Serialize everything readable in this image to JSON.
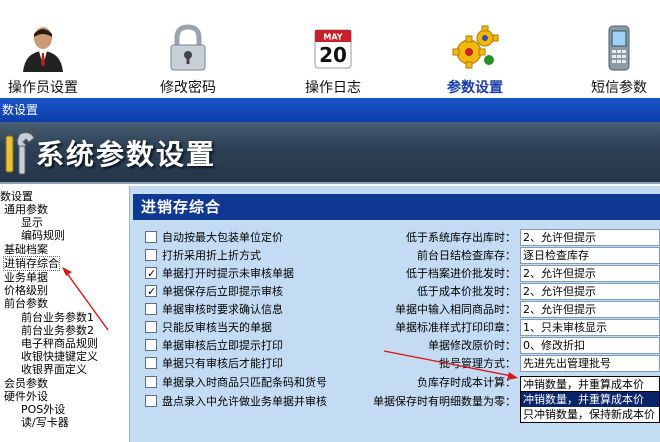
{
  "toolbar": {
    "items": [
      {
        "label": "操作员设置",
        "icon": "user-icon"
      },
      {
        "label": "修改密码",
        "icon": "lock-icon"
      },
      {
        "label": "操作日志",
        "icon": "calendar-icon",
        "day": "20",
        "month": "MAY"
      },
      {
        "label": "参数设置",
        "icon": "gears-icon",
        "active": true
      },
      {
        "label": "短信参数",
        "icon": "phone-icon"
      }
    ]
  },
  "window": {
    "title": "数设置"
  },
  "banner": {
    "title": "系统参数设置"
  },
  "tree": {
    "items": [
      {
        "label": "数设置"
      },
      {
        "label": "通用参数"
      },
      {
        "label": "显示"
      },
      {
        "label": "编码规则"
      },
      {
        "label": "基础档案"
      },
      {
        "label": "进销存综合",
        "selected": true
      },
      {
        "label": "业务单据"
      },
      {
        "label": "价格级别"
      },
      {
        "label": "前台参数"
      },
      {
        "label": "前台业务参数1"
      },
      {
        "label": "前台业务参数2"
      },
      {
        "label": "电子秤商品规则"
      },
      {
        "label": "收银快捷键定义"
      },
      {
        "label": "收银界面定义"
      },
      {
        "label": "会员参数"
      },
      {
        "label": "硬件外设"
      },
      {
        "label": "POS外设"
      },
      {
        "label": "读/写卡器"
      }
    ]
  },
  "panel": {
    "title": "进销存综合",
    "checkboxes": [
      {
        "label": "自动按最大包装单位定价",
        "checked": false
      },
      {
        "label": "打折采用折上折方式",
        "checked": false
      },
      {
        "label": "单据打开时提示未审核单据",
        "checked": true
      },
      {
        "label": "单据保存后立即提示审核",
        "checked": true
      },
      {
        "label": "单据审核时要求确认信息",
        "checked": false
      },
      {
        "label": "只能反审核当天的单据",
        "checked": false
      },
      {
        "label": "单据审核后立即提示打印",
        "checked": false
      },
      {
        "label": "单据只有审核后才能打印",
        "checked": false
      },
      {
        "label": "单据录入时商品只匹配条码和货号",
        "checked": false
      },
      {
        "label": "盘点录入中允许做业务单据并审核",
        "checked": false
      }
    ],
    "fields": [
      {
        "label": "低于系统库存出库时：",
        "value": "2、允许但提示"
      },
      {
        "label": "前台日结检查库存：",
        "value": "逐日检查库存"
      },
      {
        "label": "低于档案进价批发时：",
        "value": "2、允许但提示"
      },
      {
        "label": "低于成本价批发时：",
        "value": "2、允许但提示"
      },
      {
        "label": "单据中输入相同商品时：",
        "value": "2、允许但提示"
      },
      {
        "label": "单据标准样式打印印章：",
        "value": "1、只未审核显示"
      },
      {
        "label": "单据修改原价时：",
        "value": "0、修改折扣"
      },
      {
        "label": "批号管理方式：",
        "value": "先进先出管理批号"
      },
      {
        "label": "负库存时成本计算：",
        "value": "冲销数量，并重算成本价"
      },
      {
        "label": "单据保存时有明细数量为零：",
        "value": ""
      }
    ],
    "dropdown": {
      "options": [
        "冲销数量，并重算成本价",
        "只冲销数量，保持新成本价"
      ],
      "highlighted": 0
    }
  },
  "colors": {
    "title_bar": "#0b3ea8",
    "panel_bg": "#c4dcf3",
    "panel_header": "#0e3891",
    "annotation": "#d8161a"
  }
}
